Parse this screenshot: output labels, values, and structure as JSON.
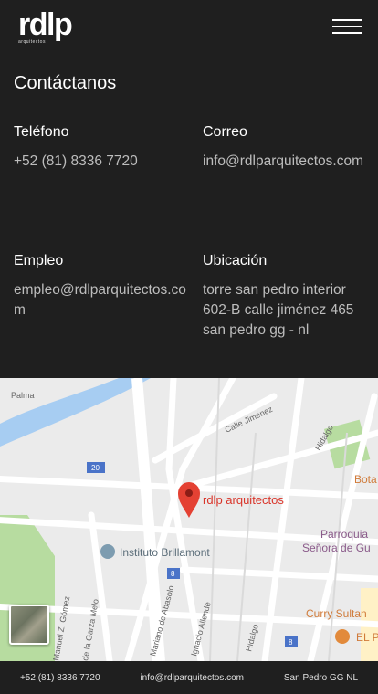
{
  "header": {
    "logo_text": "rdlp",
    "logo_subtext": "arquitectos",
    "menu_icon": "hamburger-menu-icon"
  },
  "contact": {
    "title": "Contáctanos",
    "phone": {
      "label": "Teléfono",
      "value": "+52 (81) 8336 7720"
    },
    "email": {
      "label": "Correo",
      "value": "info@rdlparquitectos.com"
    },
    "jobs": {
      "label": "Empleo",
      "value": "empleo@rdlparquitectos.com"
    },
    "location": {
      "label": "Ubicación",
      "value": "torre san pedro interior 602-B calle jiménez 465 san pedro gg - nl"
    }
  },
  "map": {
    "pin_label": "rdlp arquitectos",
    "streets": [
      "Palma",
      "Calle Jiménez",
      "Hidalgo",
      "Mariano de Abasolo",
      "Ignacio Allende",
      "Hidalgo",
      "Manuel Z. Gómez",
      "de la Garza Melo"
    ],
    "places": [
      "Instituto Brillamont",
      "Parroquia",
      "Señora de Gu",
      "Bota",
      "Curry Sultan",
      "EL P"
    ],
    "route_shields": [
      "20",
      "8",
      "8"
    ],
    "satellite_toggle": "satellite-view-thumbnail"
  },
  "footer": {
    "phone": "+52 (81) 8336 7720",
    "email": "info@rdlparquitectos.com",
    "city": "San Pedro GG NL"
  }
}
